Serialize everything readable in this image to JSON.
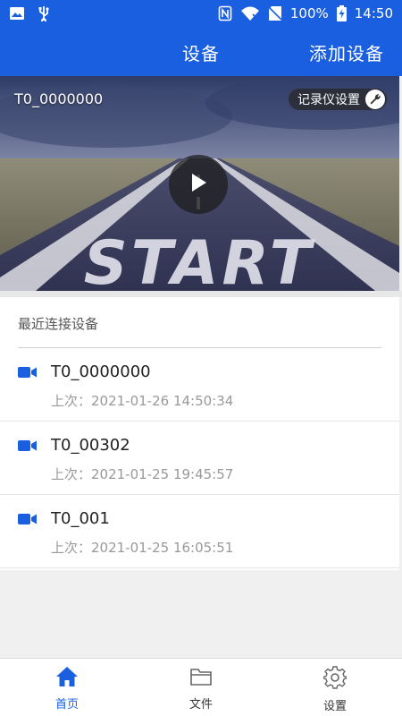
{
  "status_bar": {
    "battery": "100%",
    "time": "14:50",
    "icons": [
      "image-icon",
      "usb-icon",
      "nfc-icon",
      "wifi-off-icon",
      "no-sim-icon",
      "battery-charging-icon"
    ]
  },
  "app_bar": {
    "title": "设备",
    "add_device": "添加设备"
  },
  "banner": {
    "device_name": "T0_0000000",
    "recorder_settings": "记录仪设置",
    "scene_text": "START"
  },
  "recent": {
    "section_title": "最近连接设备",
    "items": [
      {
        "name": "T0_0000000",
        "last": "上次：2021-01-26 14:50:34"
      },
      {
        "name": "T0_00302",
        "last": "上次：2021-01-25 19:45:57"
      },
      {
        "name": "T0_001",
        "last": "上次：2021-01-25 16:05:51"
      }
    ]
  },
  "bottom_nav": {
    "items": [
      {
        "label": "首页",
        "icon": "home-icon",
        "active": true
      },
      {
        "label": "文件",
        "icon": "folder-icon",
        "active": false
      },
      {
        "label": "设置",
        "icon": "gear-icon",
        "active": false
      }
    ]
  },
  "colors": {
    "primary": "#1a5fe0",
    "text_secondary": "#999999"
  }
}
